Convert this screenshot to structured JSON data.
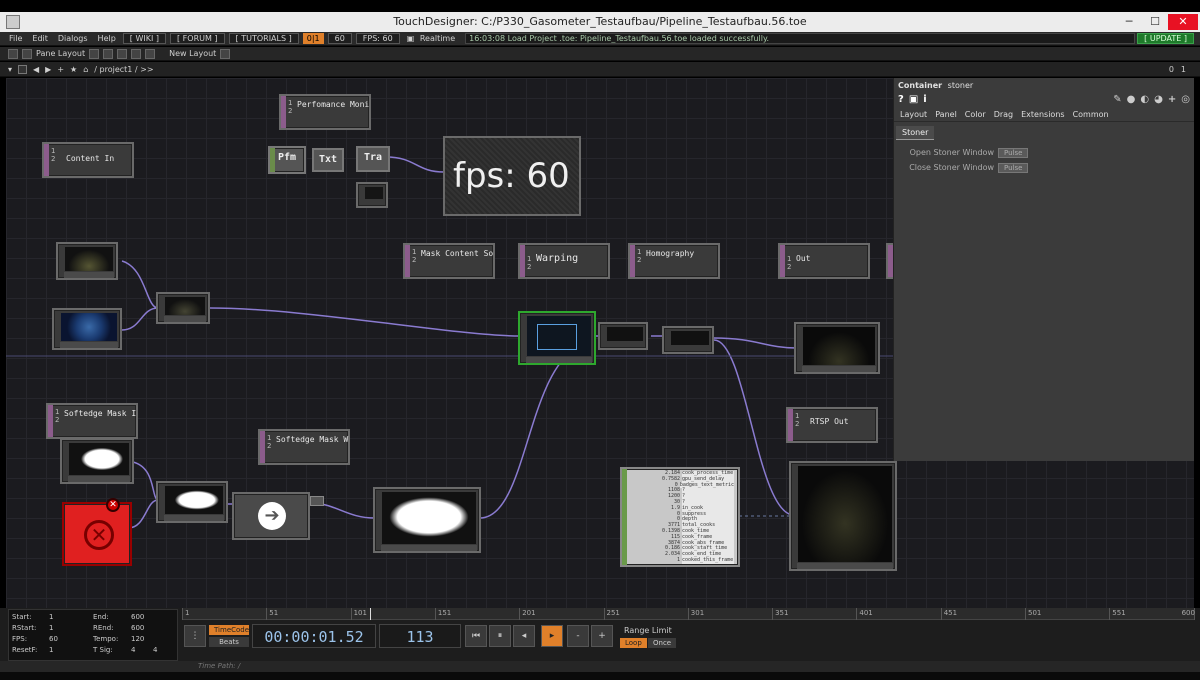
{
  "window": {
    "title": "TouchDesigner: C:/P330_Gasometer_Testaufbau/Pipeline_Testaufbau.56.toe"
  },
  "menu": {
    "items": [
      "File",
      "Edit",
      "Dialogs",
      "Help"
    ],
    "wiki": "[ WIKI ]",
    "forum": "[ FORUM ]",
    "tutorials": "[ TUTORIALS ]",
    "warn_count": "0|1",
    "fps_target": "60",
    "fps_label": "FPS: 60",
    "realtime": "Realtime",
    "message": "16:03:08 Load Project .toe: Pipeline_Testaufbau.56.toe loaded successfully.",
    "update": "[ UPDATE ]"
  },
  "toolbar": {
    "pane_layout": "Pane Layout",
    "new_layout": "New Layout"
  },
  "path": {
    "project": "/ project1 / >>",
    "right_a": "0",
    "right_b": "1"
  },
  "nodes": {
    "perf": {
      "n1": "1",
      "n2": "2",
      "label": "Perfomance Moni"
    },
    "pfm": "Pfm",
    "txt": "Txt",
    "tra": "Tra",
    "fps_text": "fps: 60",
    "content_in": {
      "n1": "1",
      "n2": "2",
      "label": "Content In"
    },
    "mask_content": {
      "n1": "1",
      "n2": "2",
      "label": "Mask Content So"
    },
    "warping": {
      "n1": "1",
      "n2": "2",
      "label": "Warping"
    },
    "homography": {
      "n1": "1",
      "n2": "2",
      "label": "Homography"
    },
    "out": {
      "n1": "1",
      "n2": "2",
      "label": "Out"
    },
    "softedge_i": {
      "n1": "1",
      "n2": "2",
      "label": "Softedge Mask I"
    },
    "softedge_w": {
      "n1": "1",
      "n2": "2",
      "label": "Softedge Mask W"
    },
    "rtsp": {
      "n1": "1",
      "n2": "2",
      "label": "RTSP Out"
    },
    "perf_table": [
      [
        "2.184",
        "cook_process_time"
      ],
      [
        "0.7582",
        "gpu_send_delay"
      ],
      [
        "0",
        "badges_text_metric"
      ],
      [
        "1108",
        "?"
      ],
      [
        "1200",
        "?"
      ],
      [
        "30",
        "?"
      ],
      [
        "1.9",
        "in_cook"
      ],
      [
        "0",
        "suppress"
      ],
      [
        "0",
        "depth"
      ],
      [
        "3771",
        "total_cooks"
      ],
      [
        "0.1398",
        "cook_time"
      ],
      [
        "115",
        "cook_frame"
      ],
      [
        "3874",
        "cook_abs_frame"
      ],
      [
        "0.186",
        "cook_start_time"
      ],
      [
        "2.034",
        "cook_end_time"
      ],
      [
        "1",
        "cooked_this_frame"
      ]
    ]
  },
  "panel": {
    "type": "Container",
    "name": "stoner",
    "tabs": [
      "Layout",
      "Panel",
      "Color",
      "Drag",
      "Extensions",
      "Common"
    ],
    "page": "Stoner",
    "params": [
      {
        "label": "Open Stoner Window",
        "button": "Pulse"
      },
      {
        "label": "Close Stoner Window",
        "button": "Pulse"
      }
    ]
  },
  "timeline": {
    "ruler": [
      "1",
      "51",
      "101",
      "151",
      "201",
      "251",
      "301",
      "351",
      "401",
      "451",
      "501",
      "551",
      "600"
    ],
    "start": "1",
    "end": "600",
    "rstart": "1",
    "rend": "600",
    "fps": "60",
    "tempo": "120",
    "resetf": "1",
    "tsig_a": "4",
    "tsig_b": "4",
    "labels": {
      "start": "Start:",
      "end": "End:",
      "rstart": "RStart:",
      "rend": "REnd:",
      "fps": "FPS:",
      "tempo": "Tempo:",
      "resetf": "ResetF:",
      "tsig": "T Sig:"
    },
    "timecode_btn": "TimeCode",
    "beats_btn": "Beats",
    "timecode": "00:00:01.52",
    "frame": "113",
    "range_limit": "Range Limit",
    "loop": "Loop",
    "once": "Once",
    "time_path": "Time Path: /"
  }
}
